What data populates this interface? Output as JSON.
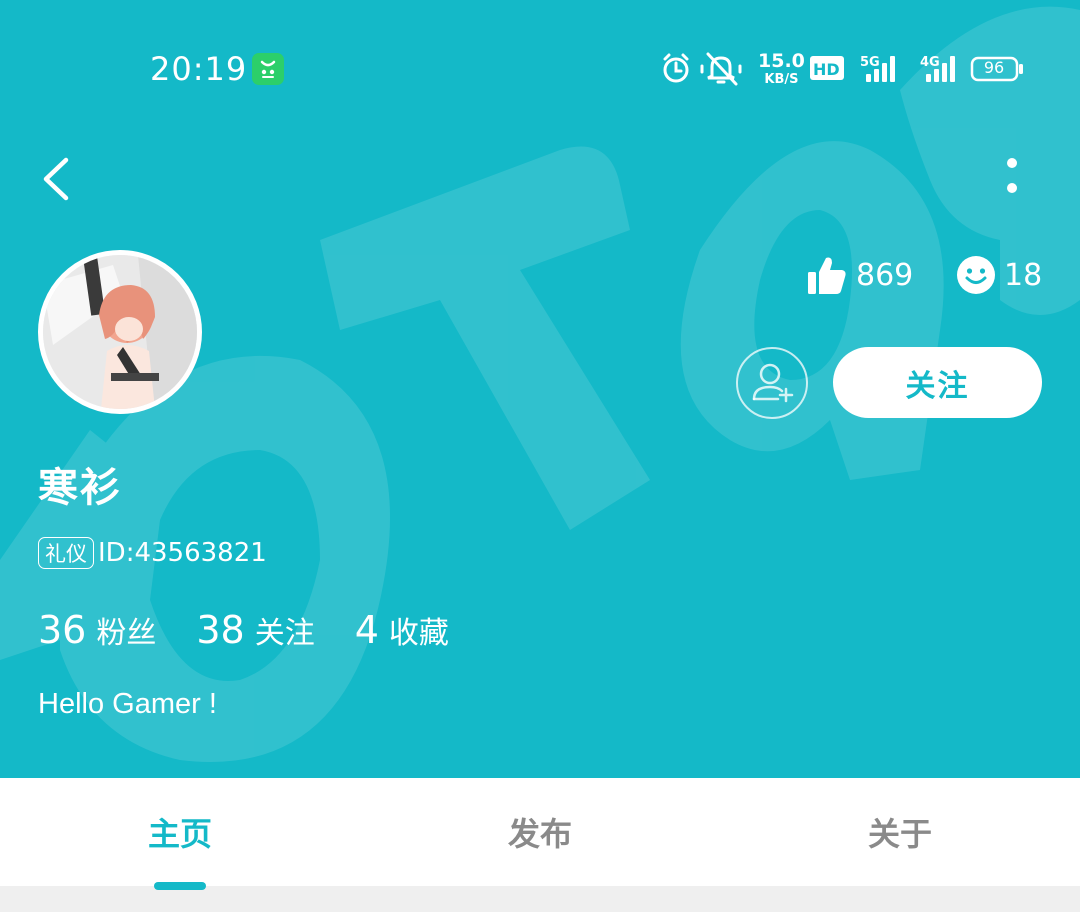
{
  "colors": {
    "primary": "#14b9c8",
    "white": "#ffffff",
    "tab_inactive": "#8a8a8a"
  },
  "status_bar": {
    "time": "20:19",
    "speed": "15.0",
    "speed_unit": "KB/S",
    "battery": "96",
    "icons": [
      "wechat-icon",
      "alarm-icon",
      "mute-icon",
      "hd-icon",
      "5g-signal-icon",
      "4g-signal-icon",
      "battery-icon"
    ]
  },
  "profile": {
    "username": "寒衫",
    "tag": "礼仪",
    "user_id": "ID:43563821",
    "likes": "869",
    "smiles": "18",
    "follow_label": "关注",
    "bio": "Hello Gamer !"
  },
  "counts": [
    {
      "number": "36",
      "label": "粉丝"
    },
    {
      "number": "38",
      "label": "关注"
    },
    {
      "number": "4",
      "label": "收藏"
    }
  ],
  "tabs": [
    {
      "label": "主页",
      "active": true
    },
    {
      "label": "发布",
      "active": false
    },
    {
      "label": "关于",
      "active": false
    }
  ]
}
